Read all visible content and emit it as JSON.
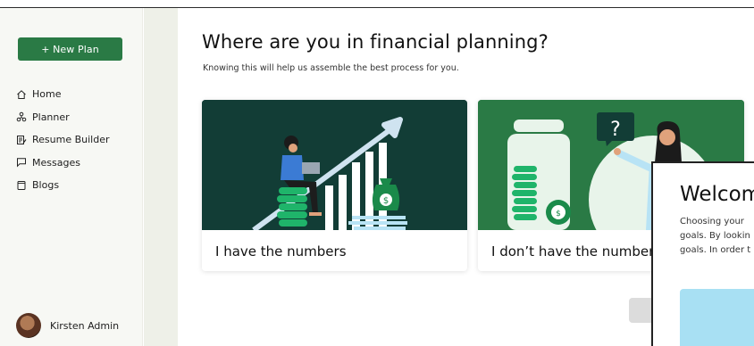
{
  "sidebar": {
    "new_plan_label": "+ New Plan",
    "items": [
      {
        "label": "Home",
        "icon": "home-icon"
      },
      {
        "label": "Planner",
        "icon": "planner-icon"
      },
      {
        "label": "Resume Builder",
        "icon": "resume-icon"
      },
      {
        "label": "Messages",
        "icon": "messages-icon"
      },
      {
        "label": "Blogs",
        "icon": "blogs-icon"
      }
    ],
    "profile_name": "Kirsten Admin"
  },
  "main": {
    "title": "Where are you in financial planning?",
    "subtitle": "Knowing this will help us assemble the best process for you.",
    "cards": [
      {
        "label": "I have the numbers"
      },
      {
        "label": "I don’t have the numbers"
      }
    ]
  },
  "modal": {
    "title": "Welcome",
    "text_lines": [
      "Choosing your",
      "goals. By lookin",
      "goals. In order t"
    ]
  },
  "colors": {
    "brand_green": "#2a7a45",
    "dark_teal": "#123d36",
    "accent_blue": "#3b7bd4",
    "light_blue": "#a8e0f3"
  }
}
